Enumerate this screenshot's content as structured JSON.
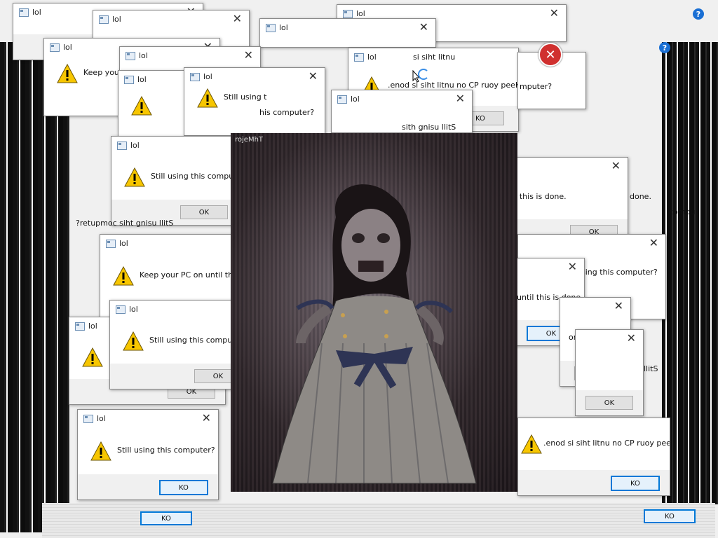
{
  "window_title": "lol",
  "messages": {
    "still_using": "Still using this computer?",
    "keep_pc_on": "Keep your PC on until this is done.",
    "still_using_mirrored": "?retupmoc siht gnisu llitS",
    "keep_pc_on_mirrored": ".enod si siht litnu no CP ruoy peeK"
  },
  "buttons": {
    "ok": "OK",
    "ok_mirrored": "KO"
  },
  "photo": {
    "caption": "rojeMhT"
  },
  "fragments": {
    "top_mirrored": "si siht litnu",
    "mid_mirrored": "sith gnisu llitS",
    "right_partial": "mputer?",
    "right_partial_2": "omputer?",
    "stills": "llitS",
    "frag_computer": "his computer?",
    "frag_done": "done.",
    "frag_keep": "Keep your",
    "frag_until": "until this is done.",
    "frag_using_this": "sing this computer?",
    "frag_still_using": "Still using t",
    "frag_compu": "compu",
    "frag_computer_right": "computer?"
  },
  "colors": {
    "accent_focus": "#0078d7",
    "error_red": "#d0302f",
    "warning_yellow": "#f7c600"
  }
}
